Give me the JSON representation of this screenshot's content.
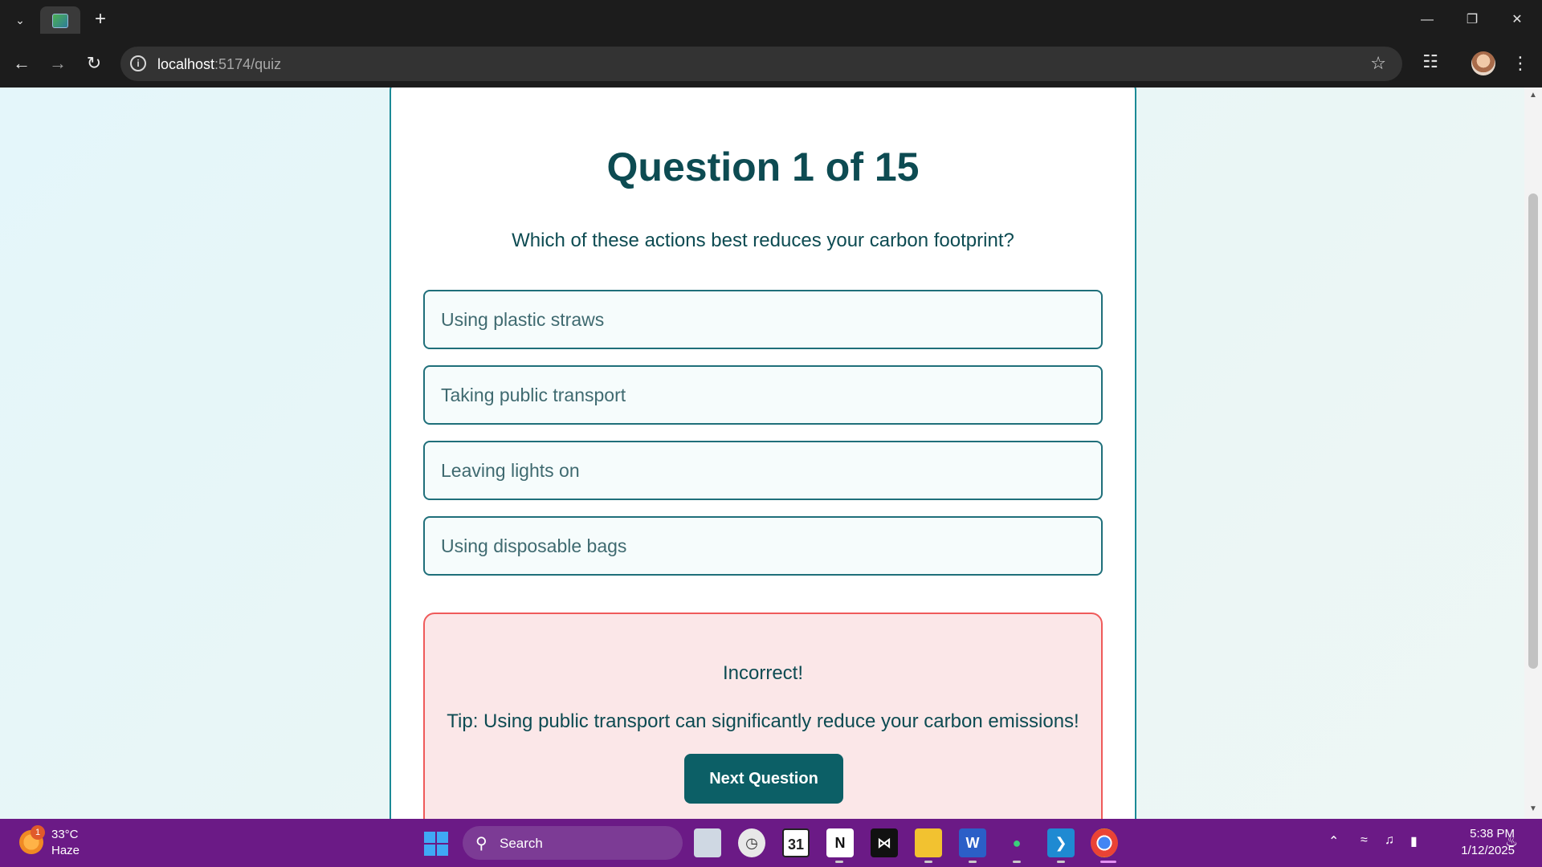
{
  "browser": {
    "url_host": "localhost",
    "url_path": ":5174/quiz"
  },
  "quiz": {
    "title": "Question 1 of 15",
    "question": "Which of these actions best reduces your carbon footprint?",
    "options": [
      {
        "label": "Using plastic straws"
      },
      {
        "label": "Taking public transport"
      },
      {
        "label": "Leaving lights on"
      },
      {
        "label": "Using disposable bags"
      }
    ],
    "feedback": {
      "status": "Incorrect!",
      "tip": "Tip: Using public transport can significantly reduce your carbon emissions!",
      "next_label": "Next Question"
    }
  },
  "taskbar": {
    "weather_badge": "1",
    "weather_temp": "33°C",
    "weather_cond": "Haze",
    "search_label": "Search",
    "clock_time": "5:38 PM",
    "clock_date": "1/12/2025",
    "apps": [
      {
        "name": "task-view"
      },
      {
        "name": "clock"
      },
      {
        "name": "calendar",
        "label": "31"
      },
      {
        "name": "notion",
        "label": "N"
      },
      {
        "name": "capcut"
      },
      {
        "name": "file-explorer"
      },
      {
        "name": "word",
        "label": "W"
      },
      {
        "name": "pear"
      },
      {
        "name": "vscode"
      },
      {
        "name": "chrome"
      }
    ]
  },
  "colors": {
    "accent": "#0c5f66",
    "card_border": "#1b8a96",
    "feedback_bg": "#fbe7e8",
    "feedback_border": "#ef5a5a",
    "taskbar": "#6b1a86"
  }
}
